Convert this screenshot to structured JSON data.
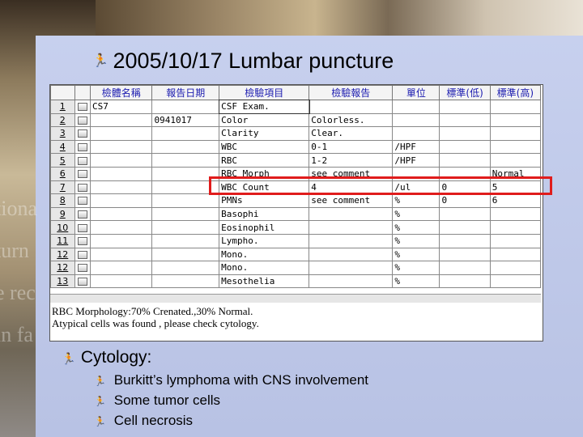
{
  "slide": {
    "title": "2005/10/17  Lumbar puncture",
    "bullet_glyph": "🏃",
    "cytology_heading": "Cytology:",
    "cytology_items": [
      "Burkitt’s lymphoma with CNS involvement",
      "Some tumor cells",
      "Cell necrosis"
    ],
    "highlight_color": "#e01c1c"
  },
  "lab_window": {
    "headers": [
      "檢體名稱",
      "報告日期",
      "檢驗項目",
      "檢驗報告",
      "單位",
      "標準(低)",
      "標準(高)"
    ],
    "rows": [
      {
        "num": "1",
        "specimen": "CS7",
        "date": "",
        "item": "CSF Exam.",
        "result": "",
        "unit": "",
        "low": "",
        "high": ""
      },
      {
        "num": "2",
        "specimen": "",
        "date": "0941017",
        "item": "Color",
        "result": "Colorless.",
        "unit": "",
        "low": "",
        "high": ""
      },
      {
        "num": "3",
        "specimen": "",
        "date": "",
        "item": "Clarity",
        "result": "Clear.",
        "unit": "",
        "low": "",
        "high": ""
      },
      {
        "num": "4",
        "specimen": "",
        "date": "",
        "item": "WBC",
        "result": "0-1",
        "unit": "/HPF",
        "low": "",
        "high": ""
      },
      {
        "num": "5",
        "specimen": "",
        "date": "",
        "item": "RBC",
        "result": "1-2",
        "unit": "/HPF",
        "low": "",
        "high": ""
      },
      {
        "num": "6",
        "specimen": "",
        "date": "",
        "item": "RBC Morph",
        "result": "see comment",
        "unit": "",
        "low": "",
        "high": "Normal"
      },
      {
        "num": "7",
        "specimen": "",
        "date": "",
        "item": "WBC Count",
        "result": "4",
        "unit": "/ul",
        "low": "0",
        "high": "5"
      },
      {
        "num": "8",
        "specimen": "",
        "date": "",
        "item": "PMNs",
        "result": "see comment",
        "unit": "%",
        "low": "0",
        "high": "6"
      },
      {
        "num": "9",
        "specimen": "",
        "date": "",
        "item": "Basophi",
        "result": "",
        "unit": "%",
        "low": "",
        "high": ""
      },
      {
        "num": "10",
        "specimen": "",
        "date": "",
        "item": "Eosinophil",
        "result": "",
        "unit": "%",
        "low": "",
        "high": ""
      },
      {
        "num": "11",
        "specimen": "",
        "date": "",
        "item": "Lympho.",
        "result": "",
        "unit": "%",
        "low": "",
        "high": ""
      },
      {
        "num": "12",
        "specimen": "",
        "date": "",
        "item": "Mono.",
        "result": "",
        "unit": "%",
        "low": "",
        "high": ""
      },
      {
        "num": "12",
        "specimen": "",
        "date": "",
        "item": "Mono.",
        "result": "",
        "unit": "%",
        "low": "",
        "high": ""
      },
      {
        "num": "13",
        "specimen": "",
        "date": "",
        "item": "Mesothelia",
        "result": "",
        "unit": "%",
        "low": "",
        "high": ""
      }
    ],
    "notes": [
      "RBC Morphology:70% Crenated.,30% Normal.",
      "Atypical cells was found , please check cytology."
    ]
  },
  "background": {
    "watermark_lines": [
      "tiona",
      "turn",
      "e rec",
      "in fa"
    ]
  }
}
